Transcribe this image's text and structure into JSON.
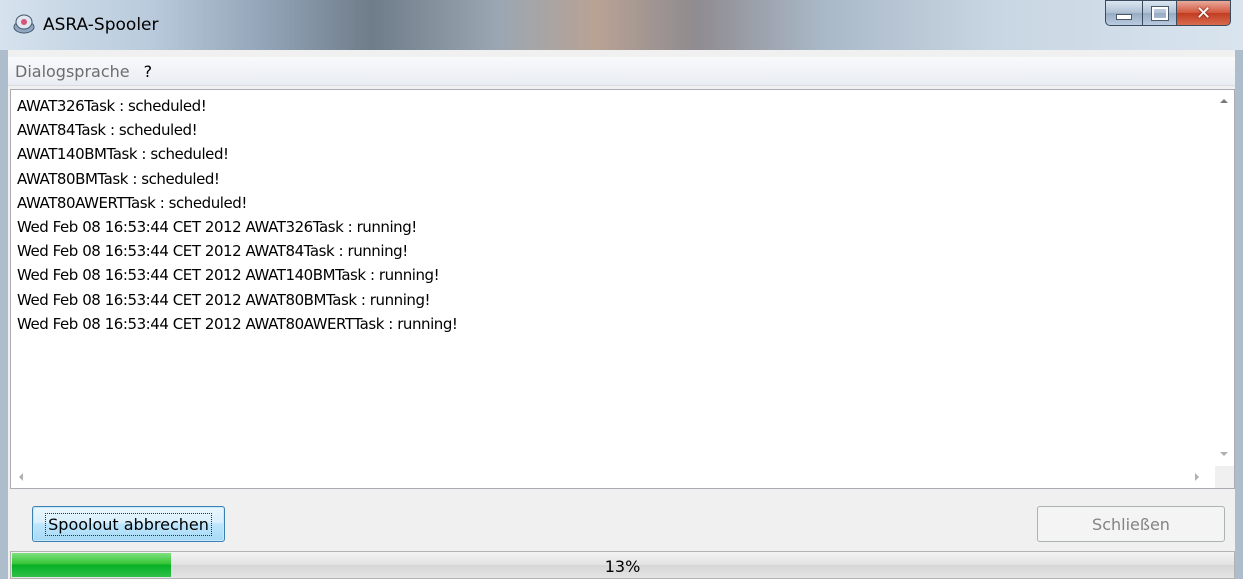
{
  "window": {
    "title": "ASRA-Spooler",
    "icon": "spooler-app-icon"
  },
  "menu": {
    "items": [
      "Dialogsprache",
      "?"
    ]
  },
  "log": {
    "lines": [
      "AWAT326Task : scheduled!",
      "AWAT84Task : scheduled!",
      "AWAT140BMTask : scheduled!",
      "AWAT80BMTask : scheduled!",
      "AWAT80AWERTTask : scheduled!",
      "Wed Feb 08 16:53:44 CET 2012 AWAT326Task : running!",
      "Wed Feb 08 16:53:44 CET 2012 AWAT84Task : running!",
      "Wed Feb 08 16:53:44 CET 2012 AWAT140BMTask : running!",
      "Wed Feb 08 16:53:44 CET 2012 AWAT80BMTask : running!",
      "Wed Feb 08 16:53:44 CET 2012 AWAT80AWERTTask : running!"
    ]
  },
  "buttons": {
    "abort_label": "Spoolout abbrechen",
    "abort_enabled": true,
    "close_label": "Schließen",
    "close_enabled": false
  },
  "progress": {
    "percent": 13,
    "text": "13%",
    "fill_color": "#06b025"
  }
}
